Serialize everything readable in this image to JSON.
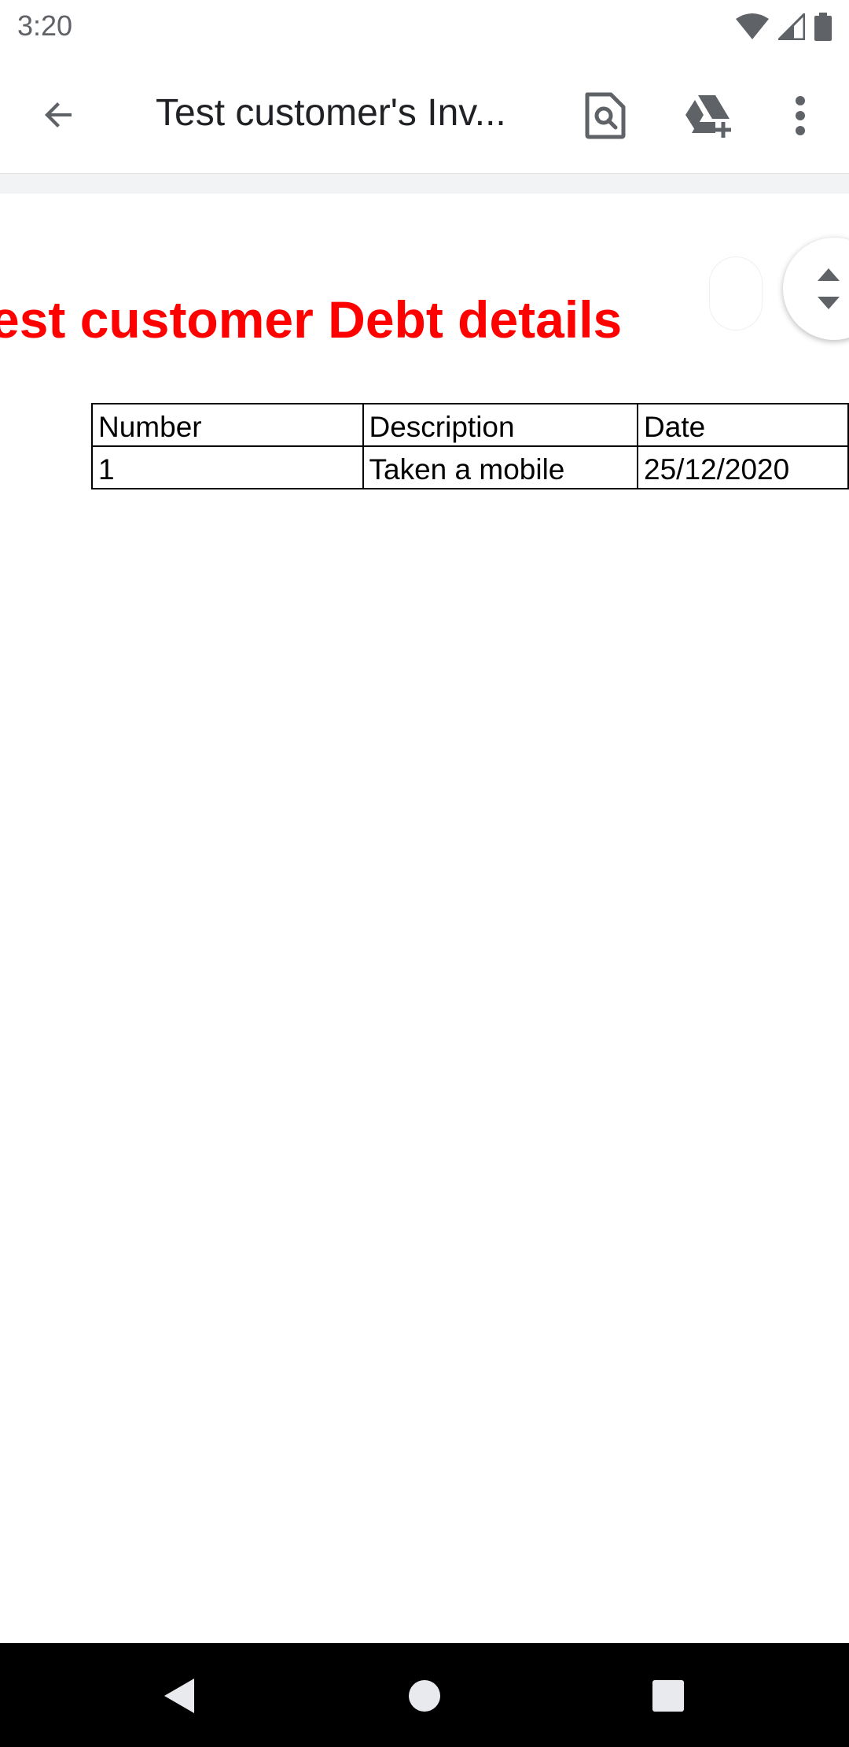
{
  "status_bar": {
    "time": "3:20",
    "icons": [
      "wifi-icon",
      "cell-signal-icon",
      "battery-icon"
    ]
  },
  "app_bar": {
    "title": "Test customer's Inv...",
    "actions": [
      "find-in-page-icon",
      "add-to-drive-icon",
      "more-vert-icon"
    ]
  },
  "document": {
    "heading": "est customer Debt details",
    "heading_color": "#ff0000",
    "table": {
      "headers": [
        "Number",
        "Description",
        "Date"
      ],
      "rows": [
        [
          "1",
          "Taken a mobile",
          "25/12/2020"
        ]
      ]
    }
  },
  "nav_bar": {
    "buttons": [
      "back-icon",
      "home-icon",
      "recents-icon"
    ]
  }
}
